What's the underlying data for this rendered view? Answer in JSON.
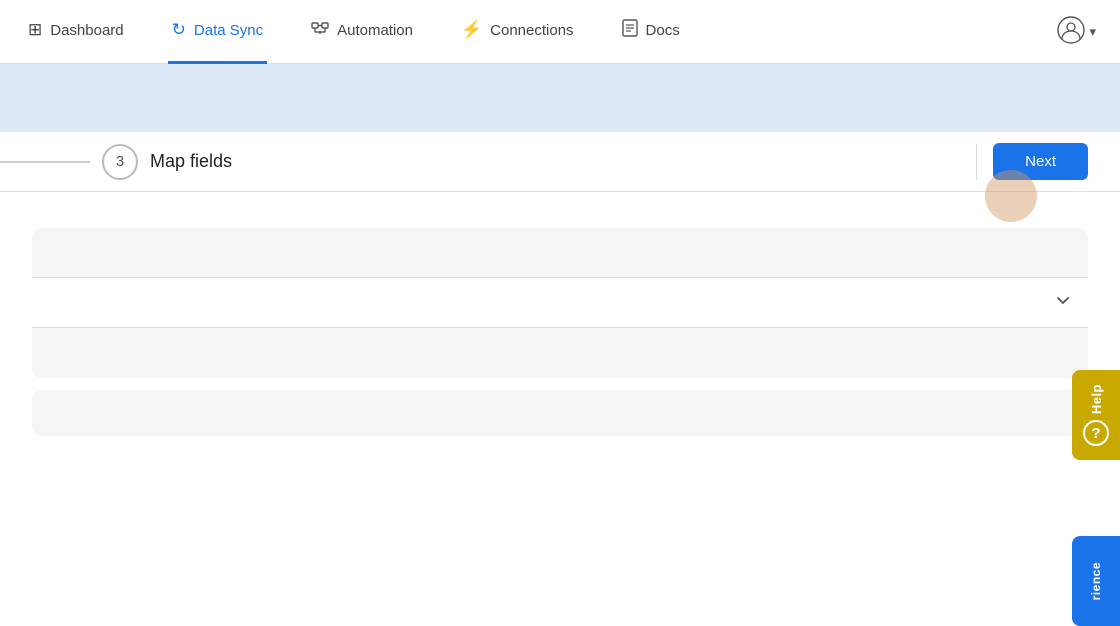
{
  "nav": {
    "items": [
      {
        "id": "dashboard",
        "label": "Dashboard",
        "icon": "⊞",
        "active": false
      },
      {
        "id": "data-sync",
        "label": "Data Sync",
        "icon": "↻",
        "active": true
      },
      {
        "id": "automation",
        "label": "Automation",
        "icon": "⬡",
        "active": false
      },
      {
        "id": "connections",
        "label": "Connections",
        "icon": "⚡",
        "active": false
      },
      {
        "id": "docs",
        "label": "Docs",
        "icon": "📄",
        "active": false
      }
    ],
    "user_icon": "👤",
    "user_arrow": "▾"
  },
  "step": {
    "number": "3",
    "title": "Map fields"
  },
  "buttons": {
    "next": "Next"
  },
  "help": {
    "label": "Help",
    "icon": "?"
  },
  "experience": {
    "label": "rience"
  },
  "colors": {
    "active_nav": "#1a73e8",
    "next_btn": "#1a73e8",
    "help_bg": "#c9a800",
    "experience_bg": "#1a73e8"
  }
}
